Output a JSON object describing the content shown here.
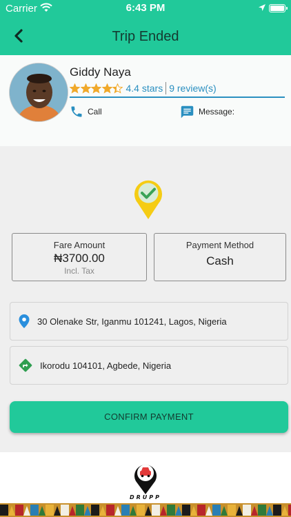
{
  "status": {
    "carrier": "Carrier",
    "time": "6:43 PM"
  },
  "nav": {
    "title": "Trip Ended"
  },
  "driver": {
    "name": "Giddy Naya",
    "rating": 4.4,
    "rating_text": "4.4 stars",
    "reviews_text": "9 review(s)",
    "call_label": "Call",
    "message_label": "Message:"
  },
  "fare": {
    "label": "Fare Amount",
    "amount": "₦3700.00",
    "tax_note": "Incl. Tax"
  },
  "payment": {
    "label": "Payment Method",
    "value": "Cash"
  },
  "addresses": {
    "pickup": "30 Olenake Str, Iganmu 101241, Lagos, Nigeria",
    "dropoff": "Ikorodu 104101, Agbede, Nigeria"
  },
  "actions": {
    "confirm_label": "CONFIRM PAYMENT"
  },
  "brand": {
    "logo_text": "DRUPP"
  },
  "colors": {
    "accent": "#21c99a",
    "link": "#2a8fc0",
    "star": "#f0a92b",
    "marker": "#f5cc14",
    "check": "#3aa357"
  },
  "icons": {
    "back": "chevron-left-icon",
    "call": "phone-icon",
    "message": "message-icon",
    "pickup": "location-pin-icon",
    "dropoff": "directions-icon",
    "status": "check-marker-icon"
  }
}
